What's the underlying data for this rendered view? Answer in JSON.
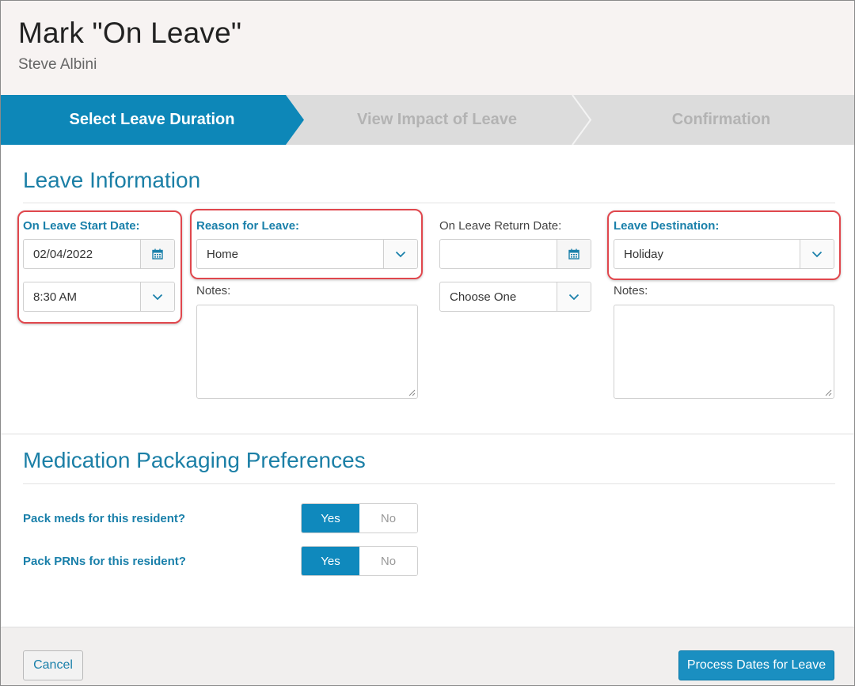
{
  "header": {
    "title": "Mark \"On Leave\"",
    "subtitle": "Steve Albini"
  },
  "steps": [
    {
      "label": "Select Leave Duration",
      "state": "active"
    },
    {
      "label": "View Impact of Leave",
      "state": "inactive"
    },
    {
      "label": "Confirmation",
      "state": "inactive"
    }
  ],
  "leave_info": {
    "section_title": "Leave Information",
    "start_date": {
      "label": "On Leave Start Date:",
      "date_value": "02/04/2022",
      "time_value": "8:30 AM"
    },
    "reason": {
      "label": "Reason for Leave:",
      "value": "Home",
      "notes_label": "Notes:"
    },
    "return_date": {
      "label": "On Leave Return Date:",
      "date_value": "",
      "time_value": "Choose One"
    },
    "destination": {
      "label": "Leave Destination:",
      "value": "Holiday",
      "notes_label": "Notes:"
    }
  },
  "medication": {
    "section_title": "Medication Packaging Preferences",
    "pack_meds": {
      "label": "Pack meds for this resident?",
      "yes": "Yes",
      "no": "No",
      "selected": "Yes"
    },
    "pack_prns": {
      "label": "Pack PRNs for this resident?",
      "yes": "Yes",
      "no": "No",
      "selected": "Yes"
    }
  },
  "footer": {
    "cancel_label": "Cancel",
    "submit_label": "Process Dates for Leave"
  },
  "colors": {
    "accent": "#1a80aa",
    "active_step": "#0d87b8",
    "highlight": "#e0474d"
  },
  "icons": [
    "calendar-icon",
    "chevron-down-icon",
    "resize-grip-icon"
  ]
}
